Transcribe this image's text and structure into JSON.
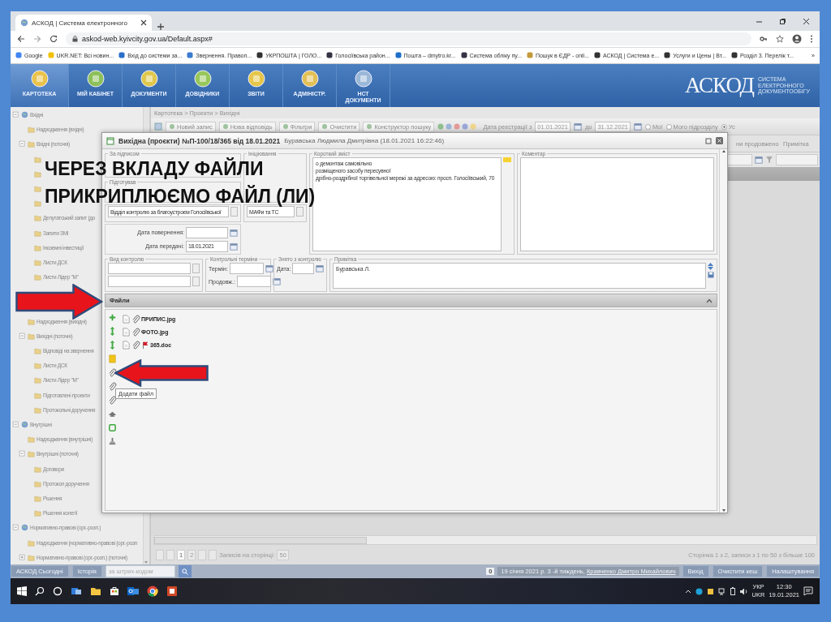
{
  "browser": {
    "tab_title": "АСКОД | Система електронного",
    "address": "askod-web.kyivcity.gov.ua/Default.aspx#",
    "bookmarks": [
      "Google",
      "UKR.NET: Всі новин...",
      "Вхід до системи за...",
      "Звернення. Правоп...",
      "УКРПОШТА | ГОЛО...",
      "Голосіївська район...",
      "Пошта – dmytro.kr...",
      "Система обліку пу...",
      "Пошук в ЄДР - onli...",
      "АСКОД | Система е...",
      "Услуги и Цены | Вт...",
      "Розділ 3. Перелік т..."
    ],
    "more": "»"
  },
  "app_nav": {
    "items": [
      {
        "label": "КАРТОТЕКА",
        "selected": true
      },
      {
        "label": "МІЙ КАБІНЕТ",
        "selected": false
      },
      {
        "label": "ДОКУМЕНТИ",
        "selected": false
      },
      {
        "label": "ДОВІДНИКИ",
        "selected": false
      },
      {
        "label": "ЗВІТИ",
        "selected": false
      },
      {
        "label": "АДМІНІСТР.",
        "selected": false
      },
      {
        "label": "НСТ\nДОКУМЕНТИ",
        "selected": false
      }
    ],
    "logo": "АСКОД",
    "logo_subtitle": [
      "СИСТЕМА",
      "ЕЛЕКТРОННОГО",
      "ДОКУМЕНТООБІГУ"
    ]
  },
  "sidebar": {
    "items": [
      {
        "kind": "group",
        "label": "Вхідні",
        "expanded": true,
        "children": [
          {
            "kind": "folder",
            "label": "Надходження (вхідні)"
          },
          {
            "kind": "folder",
            "label": "Вхідні (поточні)",
            "expanded": true,
            "children": [
              {
                "kind": "folder"
              },
              {
                "kind": "folder"
              },
              {
                "kind": "folder"
              },
              {
                "kind": "folder"
              },
              {
                "kind": "folder",
                "label": "Депутатський запит (до"
              },
              {
                "kind": "folder",
                "label": "Запити ЗМІ"
              },
              {
                "kind": "folder",
                "label": "Іноземні інвестиції"
              },
              {
                "kind": "folder",
                "label": "Листи ДСК"
              },
              {
                "kind": "folder",
                "label": "Листи Лідер \"М\""
              },
              {
                "kind": "covered"
              }
            ]
          }
        ]
      },
      {
        "kind": "covered",
        "children": [
          {
            "kind": "folder",
            "label": "Надходження (вихідні)"
          },
          {
            "kind": "folder",
            "label": "Вихідні (поточні)",
            "expanded": true,
            "children": [
              {
                "kind": "folder",
                "label": "Відповіді на звернення"
              },
              {
                "kind": "folder",
                "label": "Листи ДСК"
              },
              {
                "kind": "folder",
                "label": "Листи Лідер \"М\""
              },
              {
                "kind": "folder",
                "label": "Підготовлені проекти"
              },
              {
                "kind": "folder",
                "label": "Протокольні доручення"
              }
            ]
          }
        ]
      },
      {
        "kind": "group",
        "label": "Внутрішні",
        "expanded": true,
        "children": [
          {
            "kind": "folder",
            "label": "Надходження (внутрішні)"
          },
          {
            "kind": "folder",
            "label": "Внутрішні (поточні)",
            "expanded": true,
            "children": [
              {
                "kind": "folder",
                "label": "Договори"
              },
              {
                "kind": "folder",
                "label": "Протокол доручення"
              },
              {
                "kind": "folder",
                "label": "Рішення"
              },
              {
                "kind": "folder",
                "label": "Рішення колегії"
              }
            ]
          }
        ]
      },
      {
        "kind": "group",
        "label": "Нормативно-правові (орг.-розп.)",
        "expanded": true,
        "children": [
          {
            "kind": "folder",
            "label": "Надходження (нормативно-правові (орг.-розп"
          },
          {
            "kind": "folder",
            "label": "Нормативно-правові (орг.-розп.) (поточні)",
            "expanded": false
          }
        ]
      }
    ]
  },
  "breadcrumb": "Картотека > Проєкти > Вихідні",
  "toolbar": {
    "items": [
      {
        "kind": "button",
        "label": "Новий запис"
      },
      {
        "kind": "button",
        "label": "Нова відповідь"
      },
      {
        "kind": "button",
        "label": "Фільтри"
      },
      {
        "kind": "button",
        "label": "Очистити"
      },
      {
        "kind": "button",
        "label": "Конструктор пошуку"
      },
      {
        "kind": "date",
        "label": "Дата реєстрації з",
        "value": "01.01.2021"
      },
      {
        "kind": "date",
        "label": "до",
        "value": "31.12.2021"
      },
      {
        "kind": "radio",
        "label": "Мої",
        "selected": false
      },
      {
        "kind": "radio",
        "label": "Мого підрозділу",
        "selected": false
      },
      {
        "kind": "radio",
        "label": "Ус",
        "selected": true
      }
    ]
  },
  "grid": {
    "columns": [
      "ни продовжено",
      "Примітка"
    ]
  },
  "pager": {
    "pages": [
      {
        "label": "1",
        "selected": true
      },
      {
        "label": "2",
        "selected": false
      }
    ],
    "per_page_label": "Записів на сторінці:",
    "per_page": "50",
    "summary": "Сторінка 1 з 2, записи з 1 по 50 з більше 100"
  },
  "status_bar": {
    "left_buttons": [
      "АСКОД Сьогодні",
      "Історія"
    ],
    "search_placeholder": "за штрих-кодом",
    "counter": "0",
    "info": "19 січня 2021 р. 3 -й тиждень,",
    "user": "Кравченко Дмитро Михайлович",
    "right_buttons": [
      "Вихід",
      "Очистити кеш",
      "Налаштування"
    ]
  },
  "taskbar": {
    "language": [
      "УКР",
      "UKR"
    ],
    "time": "12:30",
    "date": "19.01.2021"
  },
  "dialog": {
    "title": "Вихідна (проєкти) №П-100/18/365 від 18.01.2021",
    "subtitle": "Буравська Людмила Дмитрівна (18.01.2021 16:22:46)",
    "signed_by_label": "За підписом",
    "prepared_by_label": "Підготував",
    "department": "Відділ контролю за благоустроєм Голосіївської",
    "return_date_label": "Дата повернення:",
    "transfer_date_label": "Дата передачі:",
    "transfer_date": "18.01.2021",
    "initiation_label": "Ініціювання",
    "topic": "МАФи та ТС",
    "summary_label": "Короткий зміст",
    "summary_lines": [
      "о демонтаж самовільно",
      "розміщеного засобу пересувної",
      "дрібно-роздрібної торгівельної мережі за адресою: просп. Голосіївський, 70"
    ],
    "comment_label": "Коментар",
    "control_type_label": "Вид контролю",
    "control_terms_label": "Контрольні терміни",
    "term_label": "Термін:",
    "extend_label": "Продовж.:",
    "removed_label": "Знято з контролю",
    "date_label": "Дата:",
    "note_label": "Примітка",
    "note": "Буравська Л.",
    "files_label": "Файли",
    "files": [
      {
        "name": "ПРИПИС.jpg",
        "flagged": false
      },
      {
        "name": "ФОТО.jpg",
        "flagged": false
      },
      {
        "name": "365.doc",
        "flagged": true
      }
    ],
    "tooltip": "Додати файл"
  },
  "annotation": {
    "lines": [
      "ЧЕРЕЗ ВКЛАДУ ФАЙЛИ",
      "ПРИКРИПЛЮЄМО ФАЙЛ (ЛИ)"
    ]
  }
}
